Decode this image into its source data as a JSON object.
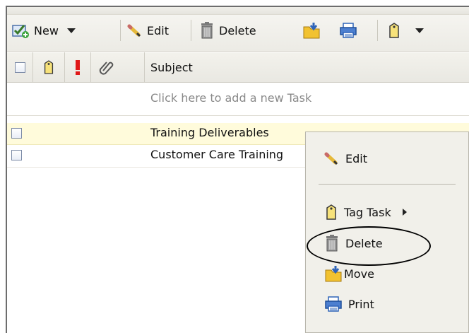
{
  "toolbar": {
    "new_label": "New",
    "edit_label": "Edit",
    "delete_label": "Delete"
  },
  "header": {
    "subject_label": "Subject"
  },
  "add_row": {
    "prompt": "Click here to add a new Task"
  },
  "tasks": [
    {
      "subject": "Training Deliverables",
      "selected": true
    },
    {
      "subject": "Customer Care Training",
      "selected": false
    }
  ],
  "context_menu": {
    "edit": "Edit",
    "tag_task": "Tag Task",
    "delete": "Delete",
    "move": "Move",
    "print": "Print"
  },
  "colors": {
    "selected_row": "#fffbdb",
    "tag_yellow": "#f7e27a",
    "priority_red": "#e01818",
    "folder_yellow": "#f2c230",
    "icon_blue": "#2f64b8"
  },
  "icons": [
    "new-task-icon",
    "pencil-icon",
    "trash-icon",
    "move-folder-icon",
    "printer-icon",
    "tag-icon",
    "priority-icon",
    "attachment-icon"
  ]
}
